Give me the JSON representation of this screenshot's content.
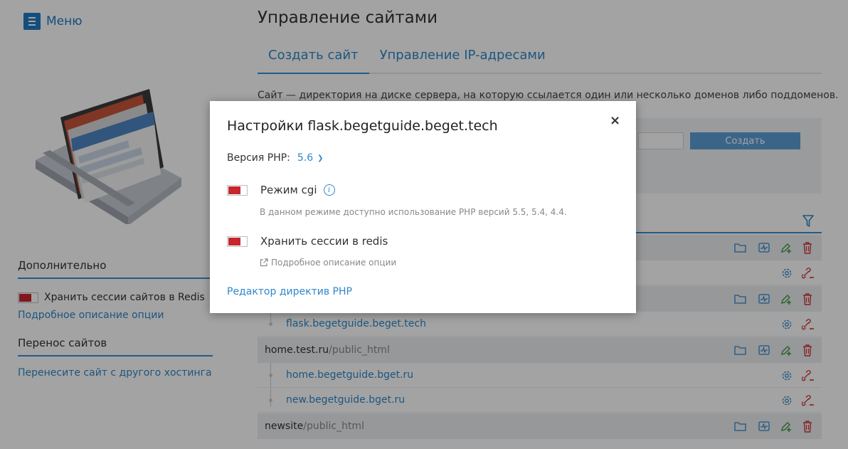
{
  "sidebar": {
    "menu_label": "Меню",
    "section_additional": "Дополнительно",
    "redis_toggle_label": "Хранить сессии сайтов в Redis",
    "redis_toggle_on": true,
    "redis_details_link": "Подробное описание опции",
    "section_transfer": "Перенос сайтов",
    "transfer_link": "Перенесите сайт с другого хостинга"
  },
  "main": {
    "title": "Управление сайтами",
    "tabs": [
      {
        "label": "Создать сайт",
        "active": true
      },
      {
        "label": "Управление IP-адресами",
        "active": false
      }
    ],
    "intro": "Сайт — директория на диске сервера, на которую ссылается один или несколько доменов либо поддоменов.",
    "create_button": "Создать",
    "domains": {
      "flask": "flask.begetguide.beget.tech",
      "home": "home.begetguide.bget.ru",
      "new": "new.begetguide.bget.ru"
    },
    "sites": {
      "home_main": "home.test.ru",
      "home_rest": "/public_html",
      "newsite_main": "newsite",
      "newsite_rest": "/public_html"
    }
  },
  "modal": {
    "title": "Настройки flask.begetguide.beget.tech",
    "php_label": "Версия PHP:",
    "php_version": "5.6",
    "cgi_label": "Режим cgi",
    "cgi_on": true,
    "cgi_hint": "В данном режиме доступно использование PHP версий 5.5, 5.4, 4.4.",
    "redis_label": "Хранить сессии в redis",
    "redis_on": true,
    "redis_hint": "Подробное описание опции",
    "php_editor_link": "Редактор директив PHP",
    "close_symbol": "×"
  },
  "colors": {
    "accent": "#2f87c9",
    "toggle_on": "#c8262d",
    "action_green": "#3d9b3d",
    "action_red": "#d0343b",
    "overlay": "rgba(0,0,0,0.36)"
  },
  "icons": [
    "menu-icon",
    "folder-icon",
    "activity-icon",
    "edit-add-icon",
    "trash-icon",
    "gear-icon",
    "unlink-icon",
    "filter-icon",
    "info-icon",
    "external-link-icon"
  ]
}
